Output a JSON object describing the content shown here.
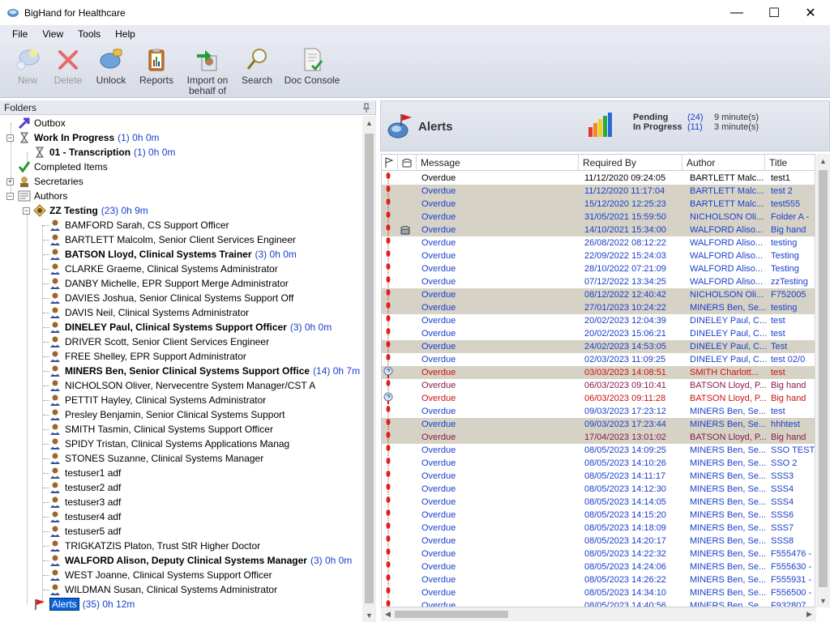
{
  "window": {
    "title": "BigHand for Healthcare",
    "min": "—",
    "max": "☐",
    "close": "✕"
  },
  "menu": [
    "File",
    "View",
    "Tools",
    "Help"
  ],
  "toolbar": [
    {
      "label": "New",
      "enabled": false,
      "icon": "new-bubble-icon"
    },
    {
      "label": "Delete",
      "enabled": false,
      "icon": "delete-x-icon"
    },
    {
      "label": "Unlock",
      "enabled": true,
      "icon": "unlock-icon"
    },
    {
      "label": "Reports",
      "enabled": true,
      "icon": "reports-clipboard-icon"
    },
    {
      "label": "Import on\nbehalf of",
      "enabled": true,
      "icon": "import-icon"
    },
    {
      "label": "Search",
      "enabled": true,
      "icon": "search-magnifier-icon"
    },
    {
      "label": "Doc Console",
      "enabled": true,
      "icon": "doc-console-icon"
    }
  ],
  "folders": {
    "header": "Folders",
    "outbox": "Outbox",
    "wip": {
      "label": "Work In Progress",
      "count": "(1) 0h 0m"
    },
    "transcription": {
      "label": "01 - Transcription",
      "count": "(1) 0h 0m"
    },
    "completed": "Completed Items",
    "secretaries": "Secretaries",
    "authors": "Authors",
    "zz": {
      "label": "ZZ Testing",
      "count": "(23) 0h 9m"
    },
    "alerts": {
      "label": "Alerts",
      "count": "(35) 0h 12m"
    },
    "people": [
      {
        "label": "BAMFORD Sarah, CS Support Officer",
        "count": "",
        "bold": false
      },
      {
        "label": "BARTLETT Malcolm, Senior Client Services Engineer",
        "count": "",
        "bold": false
      },
      {
        "label": "BATSON Lloyd, Clinical Systems Trainer",
        "count": "(3) 0h 0m",
        "bold": true
      },
      {
        "label": "CLARKE Graeme, Clinical Systems Administrator",
        "count": "",
        "bold": false
      },
      {
        "label": "DANBY Michelle, EPR Support Merge Administrator",
        "count": "",
        "bold": false
      },
      {
        "label": "DAVIES Joshua, Senior Clinical Systems Support Off",
        "count": "",
        "bold": false
      },
      {
        "label": "DAVIS Neil, Clinical Systems Administrator",
        "count": "",
        "bold": false
      },
      {
        "label": "DINELEY Paul, Clinical Systems Support Officer",
        "count": "(3) 0h 0m",
        "bold": true
      },
      {
        "label": "DRIVER Scott, Senior Client Services Engineer",
        "count": "",
        "bold": false
      },
      {
        "label": "FREE Shelley, EPR Support Administrator",
        "count": "",
        "bold": false
      },
      {
        "label": "MINERS Ben, Senior Clinical Systems Support Office",
        "count": "(14) 0h 7m",
        "bold": true
      },
      {
        "label": "NICHOLSON Oliver, Nervecentre System Manager/CST A",
        "count": "",
        "bold": false
      },
      {
        "label": "PETTIT Hayley, Clinical Systems Administrator",
        "count": "",
        "bold": false
      },
      {
        "label": "Presley Benjamin, Senior Clinical Systems Support",
        "count": "",
        "bold": false
      },
      {
        "label": "SMITH Tasmin, Clinical Systems Support Officer",
        "count": "",
        "bold": false
      },
      {
        "label": "SPIDY Tristan, Clinical Systems Applications Manag",
        "count": "",
        "bold": false
      },
      {
        "label": "STONES Suzanne, Clinical Systems Manager",
        "count": "",
        "bold": false
      },
      {
        "label": "testuser1 adf",
        "count": "",
        "bold": false
      },
      {
        "label": "testuser2 adf",
        "count": "",
        "bold": false
      },
      {
        "label": "testuser3 adf",
        "count": "",
        "bold": false
      },
      {
        "label": "testuser4 adf",
        "count": "",
        "bold": false
      },
      {
        "label": "testuser5 adf",
        "count": "",
        "bold": false
      },
      {
        "label": "TRIGKATZIS Platon, Trust StR Higher Doctor",
        "count": "",
        "bold": false
      },
      {
        "label": "WALFORD Alison, Deputy Clinical Systems Manager",
        "count": "(3) 0h 0m",
        "bold": true
      },
      {
        "label": "WEST Joanne, Clinical Systems Support Officer",
        "count": "",
        "bold": false
      },
      {
        "label": "WILDMAN Susan, Clinical Systems Administrator",
        "count": "",
        "bold": false
      }
    ]
  },
  "alerts_panel": {
    "title": "Alerts",
    "pending_label": "Pending",
    "inprogress_label": "In Progress",
    "pending_count": "(24)",
    "inprogress_count": "(11)",
    "pending_time": "9 minute(s)",
    "inprogress_time": "3 minute(s)"
  },
  "grid": {
    "columns": [
      "Message",
      "Required By",
      "Author",
      "Title"
    ],
    "rows": [
      {
        "msg": "Overdue",
        "req": "11/12/2020 09:24:05",
        "author": "BARTLETT Malc...",
        "title": "test1",
        "color": "black",
        "shade": "first",
        "icon": "flag"
      },
      {
        "msg": "Overdue",
        "req": "11/12/2020 11:17:04",
        "author": "BARTLETT Malc...",
        "title": "test 2",
        "color": "blue",
        "shade": "shaded",
        "icon": "flag"
      },
      {
        "msg": "Overdue",
        "req": "15/12/2020 12:25:23",
        "author": "BARTLETT Malc...",
        "title": "test555",
        "color": "blue",
        "shade": "shaded",
        "icon": "flag"
      },
      {
        "msg": "Overdue",
        "req": "31/05/2021 15:59:50",
        "author": "NICHOLSON Oli...",
        "title": "Folder A -",
        "color": "blue",
        "shade": "shaded",
        "icon": "flag"
      },
      {
        "msg": "Overdue",
        "req": "14/10/2021 15:34:00",
        "author": "WALFORD Aliso...",
        "title": "Big hand",
        "color": "blue",
        "shade": "shaded",
        "icon": "flag",
        "phone": true
      },
      {
        "msg": "Overdue",
        "req": "26/08/2022 08:12:22",
        "author": "WALFORD Aliso...",
        "title": "testing",
        "color": "blue",
        "shade": "",
        "icon": "flag"
      },
      {
        "msg": "Overdue",
        "req": "22/09/2022 15:24:03",
        "author": "WALFORD Aliso...",
        "title": "Testing",
        "color": "blue",
        "shade": "",
        "icon": "flag"
      },
      {
        "msg": "Overdue",
        "req": "28/10/2022 07:21:09",
        "author": "WALFORD Aliso...",
        "title": "Testing",
        "color": "blue",
        "shade": "",
        "icon": "flag"
      },
      {
        "msg": "Overdue",
        "req": "07/12/2022 13:34:25",
        "author": "WALFORD Aliso...",
        "title": "zzTesting",
        "color": "blue",
        "shade": "",
        "icon": "flag"
      },
      {
        "msg": "Overdue",
        "req": "08/12/2022 12:40:42",
        "author": "NICHOLSON Oli...",
        "title": "F752005",
        "color": "blue",
        "shade": "shaded",
        "icon": "flag"
      },
      {
        "msg": "Overdue",
        "req": "27/01/2023 10:24:22",
        "author": "MINERS Ben, Se...",
        "title": "testing",
        "color": "blue",
        "shade": "shaded",
        "icon": "flag"
      },
      {
        "msg": "Overdue",
        "req": "20/02/2023 12:04:39",
        "author": "DINELEY Paul, C...",
        "title": "test",
        "color": "blue",
        "shade": "",
        "icon": "flag"
      },
      {
        "msg": "Overdue",
        "req": "20/02/2023 15:06:21",
        "author": "DINELEY Paul, C...",
        "title": "test",
        "color": "blue",
        "shade": "",
        "icon": "flag"
      },
      {
        "msg": "Overdue",
        "req": "24/02/2023 14:53:05",
        "author": "DINELEY Paul, C...",
        "title": "Test",
        "color": "blue",
        "shade": "shaded",
        "icon": "flag"
      },
      {
        "msg": "Overdue",
        "req": "02/03/2023 11:09:25",
        "author": "DINELEY Paul, C...",
        "title": "test 02/0",
        "color": "blue",
        "shade": "",
        "icon": "flag"
      },
      {
        "msg": "Overdue",
        "req": "03/03/2023 14:08:51",
        "author": "SMITH Charlott...",
        "title": "test",
        "color": "red",
        "shade": "shaded",
        "icon": "query"
      },
      {
        "msg": "Overdue",
        "req": "06/03/2023 09:10:41",
        "author": "BATSON Lloyd, P...",
        "title": "Big hand",
        "color": "maroon",
        "shade": "",
        "icon": "flag"
      },
      {
        "msg": "Overdue",
        "req": "06/03/2023 09:11:28",
        "author": "BATSON Lloyd, P...",
        "title": "Big hand",
        "color": "red",
        "shade": "",
        "icon": "query"
      },
      {
        "msg": "Overdue",
        "req": "09/03/2023 17:23:12",
        "author": "MINERS Ben, Se...",
        "title": "test",
        "color": "blue",
        "shade": "",
        "icon": "flag"
      },
      {
        "msg": "Overdue",
        "req": "09/03/2023 17:23:44",
        "author": "MINERS Ben, Se...",
        "title": "hhhtest",
        "color": "blue",
        "shade": "shaded",
        "icon": "flag"
      },
      {
        "msg": "Overdue",
        "req": "17/04/2023 13:01:02",
        "author": "BATSON Lloyd, P...",
        "title": "Big hand",
        "color": "maroon",
        "shade": "shaded",
        "icon": "flag"
      },
      {
        "msg": "Overdue",
        "req": "08/05/2023 14:09:25",
        "author": "MINERS Ben, Se...",
        "title": "SSO TEST 1",
        "color": "blue",
        "shade": "",
        "icon": "flag"
      },
      {
        "msg": "Overdue",
        "req": "08/05/2023 14:10:26",
        "author": "MINERS Ben, Se...",
        "title": "SSO 2",
        "color": "blue",
        "shade": "",
        "icon": "flag"
      },
      {
        "msg": "Overdue",
        "req": "08/05/2023 14:11:17",
        "author": "MINERS Ben, Se...",
        "title": "SSS3",
        "color": "blue",
        "shade": "",
        "icon": "flag"
      },
      {
        "msg": "Overdue",
        "req": "08/05/2023 14:12:30",
        "author": "MINERS Ben, Se...",
        "title": "SSS4",
        "color": "blue",
        "shade": "",
        "icon": "flag"
      },
      {
        "msg": "Overdue",
        "req": "08/05/2023 14:14:05",
        "author": "MINERS Ben, Se...",
        "title": "SSS4",
        "color": "blue",
        "shade": "",
        "icon": "flag"
      },
      {
        "msg": "Overdue",
        "req": "08/05/2023 14:15:20",
        "author": "MINERS Ben, Se...",
        "title": "SSS6",
        "color": "blue",
        "shade": "",
        "icon": "flag"
      },
      {
        "msg": "Overdue",
        "req": "08/05/2023 14:18:09",
        "author": "MINERS Ben, Se...",
        "title": "SSS7",
        "color": "blue",
        "shade": "",
        "icon": "flag"
      },
      {
        "msg": "Overdue",
        "req": "08/05/2023 14:20:17",
        "author": "MINERS Ben, Se...",
        "title": "SSS8",
        "color": "blue",
        "shade": "",
        "icon": "flag"
      },
      {
        "msg": "Overdue",
        "req": "08/05/2023 14:22:32",
        "author": "MINERS Ben, Se...",
        "title": "F555476 -",
        "color": "blue",
        "shade": "",
        "icon": "flag"
      },
      {
        "msg": "Overdue",
        "req": "08/05/2023 14:24:06",
        "author": "MINERS Ben, Se...",
        "title": "F555630 -",
        "color": "blue",
        "shade": "",
        "icon": "flag"
      },
      {
        "msg": "Overdue",
        "req": "08/05/2023 14:26:22",
        "author": "MINERS Ben, Se...",
        "title": "F555931 -",
        "color": "blue",
        "shade": "",
        "icon": "flag"
      },
      {
        "msg": "Overdue",
        "req": "08/05/2023 14:34:10",
        "author": "MINERS Ben, Se...",
        "title": "F556500 -",
        "color": "blue",
        "shade": "",
        "icon": "flag"
      },
      {
        "msg": "Overdue",
        "req": "08/05/2023 14:40:56",
        "author": "MINERS Ben, Se...",
        "title": "F932807",
        "color": "blue",
        "shade": "",
        "icon": "flag"
      }
    ]
  }
}
